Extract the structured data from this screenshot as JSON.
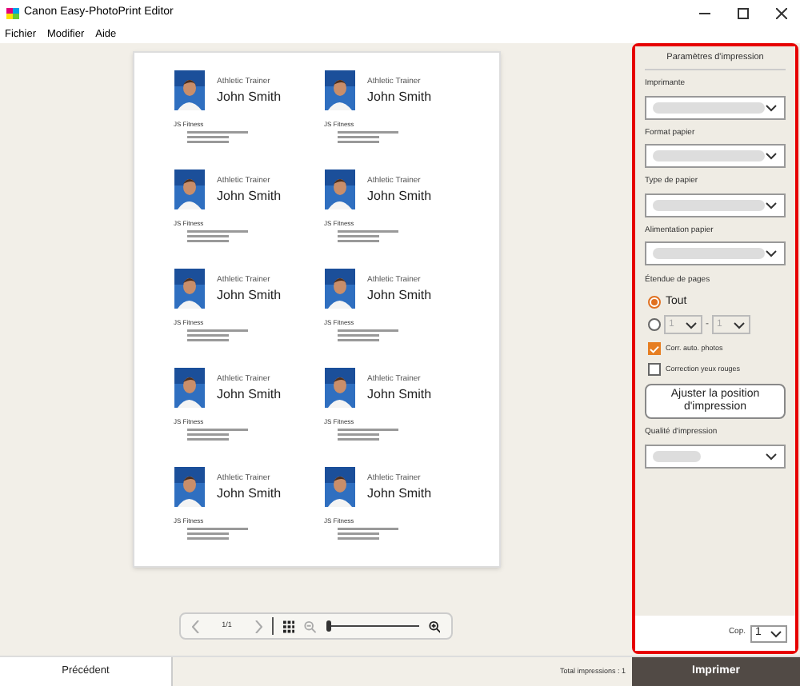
{
  "window": {
    "title": "Canon Easy-PhotoPrint Editor"
  },
  "menu": [
    "Fichier",
    "Modifier",
    "Aide"
  ],
  "cards": [
    {
      "job_title": "Athletic Trainer",
      "name": "John Smith",
      "company": "JS Fitness"
    },
    {
      "job_title": "Athletic Trainer",
      "name": "John Smith",
      "company": "JS Fitness"
    },
    {
      "job_title": "Athletic Trainer",
      "name": "John Smith",
      "company": "JS Fitness"
    },
    {
      "job_title": "Athletic Trainer",
      "name": "John Smith",
      "company": "JS Fitness"
    },
    {
      "job_title": "Athletic Trainer",
      "name": "John Smith",
      "company": "JS Fitness"
    },
    {
      "job_title": "Athletic Trainer",
      "name": "John Smith",
      "company": "JS Fitness"
    },
    {
      "job_title": "Athletic Trainer",
      "name": "John Smith",
      "company": "JS Fitness"
    },
    {
      "job_title": "Athletic Trainer",
      "name": "John Smith",
      "company": "JS Fitness"
    },
    {
      "job_title": "Athletic Trainer",
      "name": "John Smith",
      "company": "JS Fitness"
    },
    {
      "job_title": "Athletic Trainer",
      "name": "John Smith",
      "company": "JS Fitness"
    }
  ],
  "navigator": {
    "page": "1/1",
    "zoom": {
      "level": 0
    }
  },
  "panel": {
    "title": "Paramètres d'impression",
    "dropdowns": [
      {
        "label": "Imprimante"
      },
      {
        "label": "Format papier"
      },
      {
        "label": "Type de papier"
      },
      {
        "label": "Alimentation papier"
      }
    ],
    "page_range": {
      "label": "Étendue de pages",
      "options": [
        {
          "kind": "all",
          "label": "Tout",
          "selected": true
        },
        {
          "kind": "range",
          "from": "1",
          "separator": "-",
          "to": "1",
          "selected": false
        }
      ]
    },
    "checkboxes": [
      {
        "label": "Corr. auto. photos",
        "checked": true
      },
      {
        "label": "Correction yeux rouges",
        "checked": false
      }
    ],
    "adjust_button": "Ajuster la position d'impression",
    "quality": {
      "label": "Qualité d'impression"
    },
    "copies": {
      "label": "Cop.",
      "value": "1"
    }
  },
  "footer": {
    "back": "Précédent",
    "total": "Total impressions : 1",
    "print": "Imprimer"
  }
}
